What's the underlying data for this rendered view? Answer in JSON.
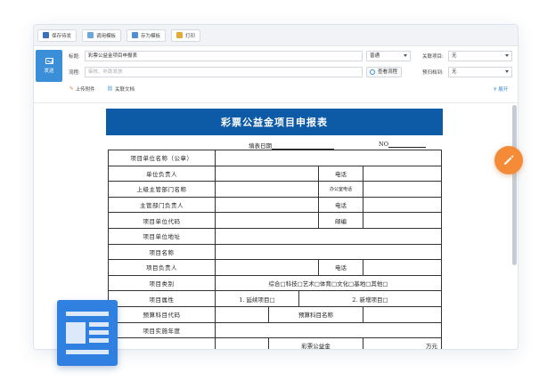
{
  "toolbar": {
    "save_draft": "保存待发",
    "use_template": "调用模板",
    "save_as_template": "存为模板",
    "print": "打印"
  },
  "form": {
    "send_label": "发送",
    "title_label": "标题:",
    "title_value": "彩票公益金项目申报表",
    "flow_label": "流程:",
    "flow_placeholder": "审核、补助发放",
    "priority_value": "普通",
    "view_flow_label": "查看流程",
    "related_project_label": "关联项目:",
    "related_project_value": "无",
    "archive_label": "预归档到:",
    "archive_value": "无",
    "upload_attachment": "上传附件",
    "related_doc": "关联文档",
    "expand": "展开"
  },
  "document": {
    "title": "彩票公益金项目申报表",
    "fill_date_label": "填表日期",
    "no_label": "NO",
    "rows": {
      "unit_name": "项目单位名称（公章）",
      "unit_head": "单位负责人",
      "phone": "电话",
      "superior_dept": "上级主管部门名称",
      "office_phone": "办公室电话",
      "dept_head": "主管部门负责人",
      "unit_code": "项目单位代码",
      "postcode": "邮编",
      "unit_address": "项目单位地址",
      "project_name": "项目名称",
      "project_head": "项目负责人",
      "project_category": "项目类别",
      "category_options": "综合□科技□艺术□体育□文化□基地□其他□",
      "project_attribute": "项目属性",
      "attribute_options_1": "1. 延续项目□",
      "attribute_options_2": "2. 新增项目□",
      "budget_code": "预算科目代码",
      "budget_name": "预算科目名称",
      "project_year": "项目实施年度",
      "lottery_fund": "彩票公益金",
      "wan_yuan": "万元"
    }
  },
  "colors": {
    "accent_blue": "#3b8fd8",
    "doc_title_bg": "#0d5aa7",
    "edit_fab": "#f58a37",
    "badge_blue": "#2f80e0"
  },
  "icons": {
    "edit": "pencil-icon",
    "doc": "document-layout-icon"
  }
}
